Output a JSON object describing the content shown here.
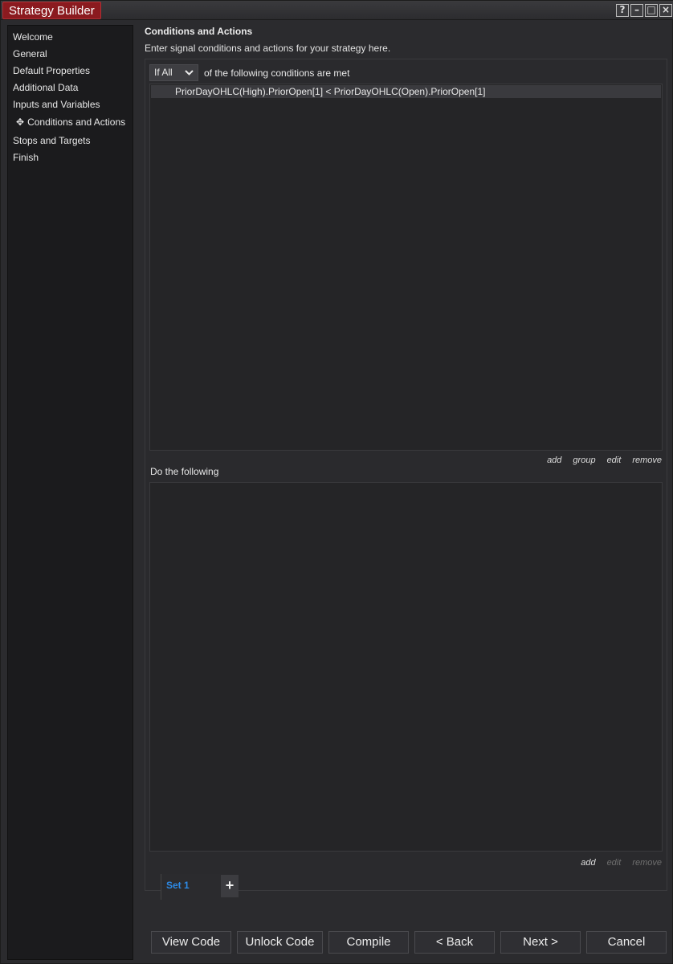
{
  "window": {
    "title": "Strategy Builder",
    "controls": [
      "?",
      "–",
      "□",
      "×"
    ]
  },
  "sidebar": {
    "items": [
      {
        "label": "Welcome"
      },
      {
        "label": "General"
      },
      {
        "label": "Default Properties"
      },
      {
        "label": "Additional Data"
      },
      {
        "label": "Inputs and Variables"
      },
      {
        "label": "Conditions and Actions",
        "active": true,
        "marker": "✥"
      },
      {
        "label": "Stops and Targets"
      },
      {
        "label": "Finish"
      }
    ]
  },
  "main": {
    "title": "Conditions and Actions",
    "subtitle": "Enter signal conditions and actions for your strategy here.",
    "conditions": {
      "mode_selected": "If All",
      "description": "of the following conditions are met",
      "rows": [
        "PriorDayOHLC(High).PriorOpen[1] < PriorDayOHLC(Open).PriorOpen[1]"
      ],
      "actions": {
        "add": "add",
        "group": "group",
        "edit": "edit",
        "remove": "remove"
      }
    },
    "do_following": {
      "label": "Do the following",
      "actions": {
        "add": "add",
        "edit": "edit",
        "remove": "remove"
      }
    },
    "tabs": [
      {
        "label": "Set 1",
        "active": true
      }
    ],
    "add_tab_symbol": "+"
  },
  "footer": {
    "view_code": "View Code",
    "unlock_code": "Unlock Code",
    "compile": "Compile",
    "back": "< Back",
    "next": "Next >",
    "cancel": "Cancel"
  },
  "colors": {
    "title_accent": "#8b1a1f",
    "tab_active_text": "#2d8ae6",
    "background": "#2b2b2e",
    "sidebar_bg": "#1b1b1d"
  }
}
